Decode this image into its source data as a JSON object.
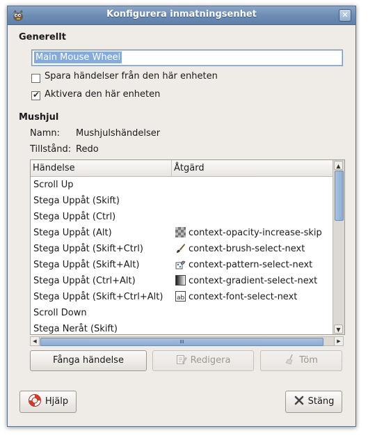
{
  "window": {
    "title": "Konfigurera inmatningsenhet"
  },
  "general": {
    "heading": "Generellt",
    "device_name": "Main Mouse Wheel",
    "save_events_label": "Spara händelser från den här enheten",
    "save_events_checked": false,
    "enable_device_label": "Aktivera den här enheten",
    "enable_device_checked": true
  },
  "wheel": {
    "heading": "Mushjul",
    "name_label": "Namn:",
    "name_value": "Mushjulshändelser",
    "state_label": "Tillstånd:",
    "state_value": "Redo"
  },
  "table": {
    "columns": [
      "Händelse",
      "Åtgärd"
    ],
    "rows": [
      {
        "event": "Scroll Up",
        "action": "",
        "icon": ""
      },
      {
        "event": "Stega Uppåt (Skift)",
        "action": "",
        "icon": ""
      },
      {
        "event": "Stega Uppåt (Ctrl)",
        "action": "",
        "icon": ""
      },
      {
        "event": "Stega Uppåt (Alt)",
        "action": "context-opacity-increase-skip",
        "icon": "opacity-icon"
      },
      {
        "event": "Stega Uppåt (Skift+Ctrl)",
        "action": "context-brush-select-next",
        "icon": "brush-icon"
      },
      {
        "event": "Stega Uppåt (Skift+Alt)",
        "action": "context-pattern-select-next",
        "icon": "pattern-icon"
      },
      {
        "event": "Stega Uppåt (Ctrl+Alt)",
        "action": "context-gradient-select-next",
        "icon": "gradient-icon"
      },
      {
        "event": "Stega Uppåt (Skift+Ctrl+Alt)",
        "action": "context-font-select-next",
        "icon": "font-icon"
      },
      {
        "event": "Scroll Down",
        "action": "",
        "icon": ""
      },
      {
        "event": "Stega Neråt (Skift)",
        "action": "",
        "icon": ""
      }
    ]
  },
  "buttons": {
    "grab": "Fånga händelse",
    "edit": "Redigera",
    "clear": "Töm",
    "help": "Hjälp",
    "close": "Stäng"
  }
}
